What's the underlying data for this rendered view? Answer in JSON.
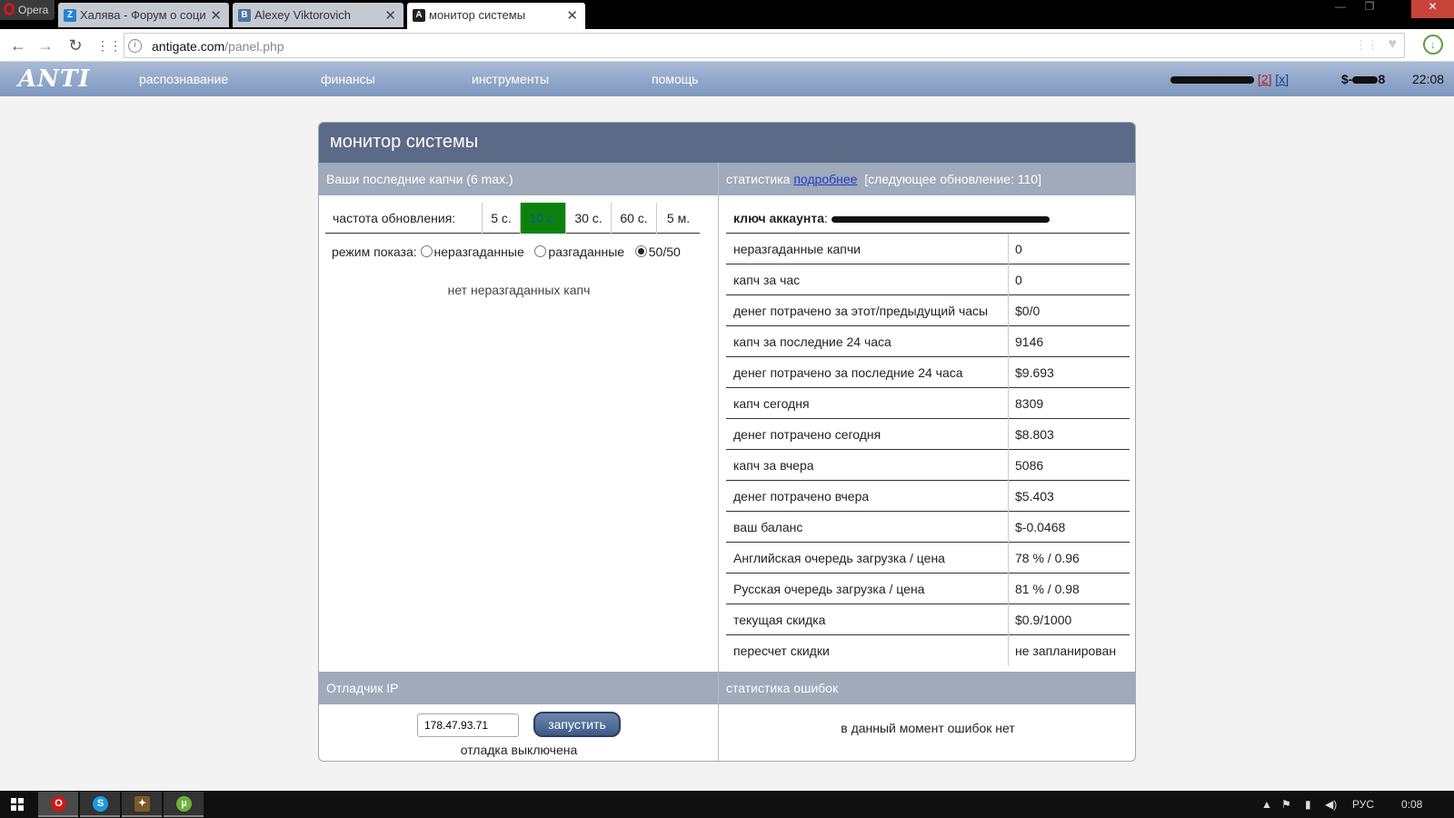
{
  "browser": {
    "opera_label": "Opera",
    "tabs": [
      {
        "title": "Халява - Форум о социал",
        "favicon": "Z"
      },
      {
        "title": "Alexey Viktorovich",
        "favicon": "B"
      },
      {
        "title": "монитор системы",
        "favicon": "A"
      }
    ],
    "url_host": "antigate.com",
    "url_path": "/panel.php"
  },
  "header": {
    "logo": "ANTI",
    "nav": [
      "распознавание",
      "финансы",
      "инструменты",
      "помощь"
    ],
    "count_link": "[2]",
    "close_link": "[x]",
    "balance_prefix": "$-",
    "balance_suffix": "8",
    "time": "22:08"
  },
  "panel": {
    "title": "монитор системы",
    "left_header": "Ваши последние капчи (6 max.)",
    "refresh_label": "частота обновления:",
    "refresh_options": [
      "5 с.",
      "10 с.",
      "30 с.",
      "60 с.",
      "5 м."
    ],
    "refresh_selected": "10 с.",
    "mode_label": "режим показа:",
    "modes": [
      "неразгаданные",
      "разгаданные",
      "50/50"
    ],
    "mode_selected": "50/50",
    "no_captchas": "нет неразгаданных капч",
    "right_header_prefix": "статистика",
    "right_header_link": "подробнее",
    "right_header_suffix": "[следующее обновление: 110]",
    "account_key_label": "ключ аккаунта",
    "stats": [
      {
        "label": "неразгаданные капчи",
        "value": "0"
      },
      {
        "label": "капч за час",
        "value": "0"
      },
      {
        "label": "денег потрачено за этот/предыдущий часы",
        "value": "$0/0"
      },
      {
        "label": "капч за последние 24 часа",
        "value": "9146"
      },
      {
        "label": "денег потрачено за последние 24 часа",
        "value": "$9.693"
      },
      {
        "label": "капч сегодня",
        "value": "8309"
      },
      {
        "label": "денег потрачено сегодня",
        "value": "$8.803"
      },
      {
        "label": "капч за вчера",
        "value": "5086"
      },
      {
        "label": "денег потрачено вчера",
        "value": "$5.403"
      },
      {
        "label": "ваш баланс",
        "value": "$-0.0468"
      },
      {
        "label": "Английская очередь загрузка / цена",
        "value": "78 % / 0.96"
      },
      {
        "label": "Русская очередь загрузка / цена",
        "value": "81 % / 0.98"
      },
      {
        "label": "текущая скидка",
        "value": "$0.9/1000"
      },
      {
        "label": "пересчет скидки",
        "value": "не запланирован"
      }
    ],
    "ip_debugger_header": "Отладчик IP",
    "ip_value": "178.47.93.71",
    "run_button": "запустить",
    "debug_status": "отладка выключена",
    "errors_header": "статистика ошибок",
    "errors_text": "в данный момент ошибок нет"
  },
  "taskbar": {
    "lang": "РУС",
    "time": "0:08"
  }
}
